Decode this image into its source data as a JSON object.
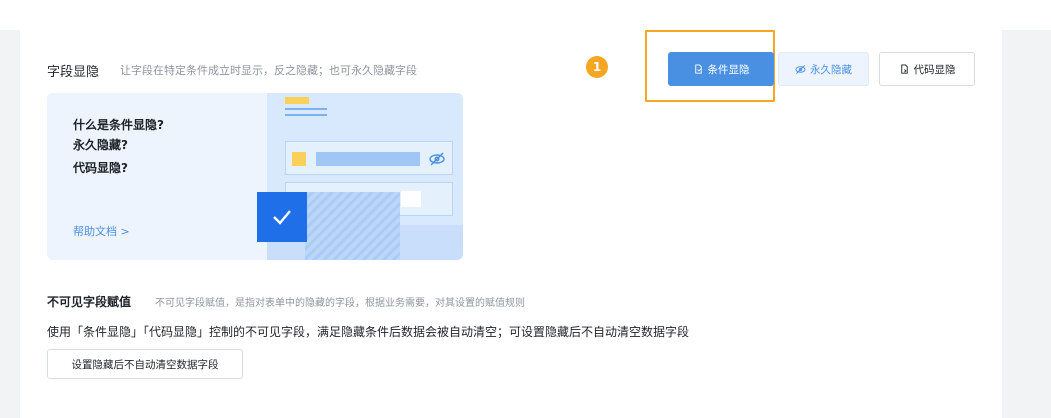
{
  "section": {
    "title": "字段显隐",
    "description": "让字段在特定条件成立时显示，反之隐藏；也可永久隐藏字段"
  },
  "annotation": {
    "badge_number": "1"
  },
  "buttons": {
    "conditional": "条件显隐",
    "permanent": "永久隐藏",
    "code": "代码显隐"
  },
  "help_card": {
    "questions": [
      "什么是条件显隐?",
      "永久隐藏?",
      "代码显隐?"
    ],
    "link_label": "帮助文档 >"
  },
  "invisible": {
    "title": "不可见字段赋值",
    "description": "不可见字段赋值，是指对表单中的隐藏的字段，根据业务需要，对其设置的赋值规则",
    "text": "使用「条件显隐」「代码显隐」控制的不可见字段，满足隐藏条件后数据会被自动清空；可设置隐藏后不自动清空数据字段",
    "button": "设置隐藏后不自动清空数据字段"
  },
  "colors": {
    "primary": "#4a90e2",
    "highlight": "#f5a623",
    "check": "#1e6fe8"
  },
  "icons": [
    "doc-condition-icon",
    "eye-slash-icon",
    "doc-code-icon",
    "check-icon"
  ]
}
